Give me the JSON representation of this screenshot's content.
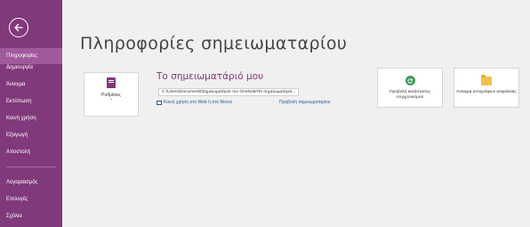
{
  "sidebar": {
    "items": [
      {
        "label": "Πληροφορίες",
        "active": true
      },
      {
        "label": "Δημιουργία",
        "active": false
      },
      {
        "label": "Άνοιγμα",
        "active": false
      },
      {
        "label": "Εκτύπωση",
        "active": false
      },
      {
        "label": "Κοινή χρήση",
        "active": false
      },
      {
        "label": "Εξαγωγή",
        "active": false
      },
      {
        "label": "Αποστολή",
        "active": false
      },
      {
        "label": "Λογαριασμός",
        "active": false
      },
      {
        "label": "Επιλογές",
        "active": false
      },
      {
        "label": "Σχόλια",
        "active": false
      }
    ]
  },
  "main": {
    "title": "Πληροφορίες σημειωματαρίου",
    "settings_label": "Ρυθμίσεις",
    "settings_chevron": "˅",
    "notebook_name": "Το σημειωματάριό μου",
    "notebook_path": "C:\\Users\\Documents\\Σημειωματάρια του OneNote\\Το σημειωματάριό...",
    "share_link": "Κοινή χρήση στο Web ή στο δίκτυο",
    "properties_link": "Προβολή σημειωματαρίου",
    "sync_button": "Προβολή κατάστασης συγχρονισμού",
    "backup_button": "Άνοιγμα αντιγράφων ασφαλείας"
  },
  "colors": {
    "accent": "#80397b",
    "active_item": "#a05a9b",
    "link": "#2b579a",
    "sync_icon": "#3f9c5c",
    "folder_icon": "#f2c14e"
  }
}
